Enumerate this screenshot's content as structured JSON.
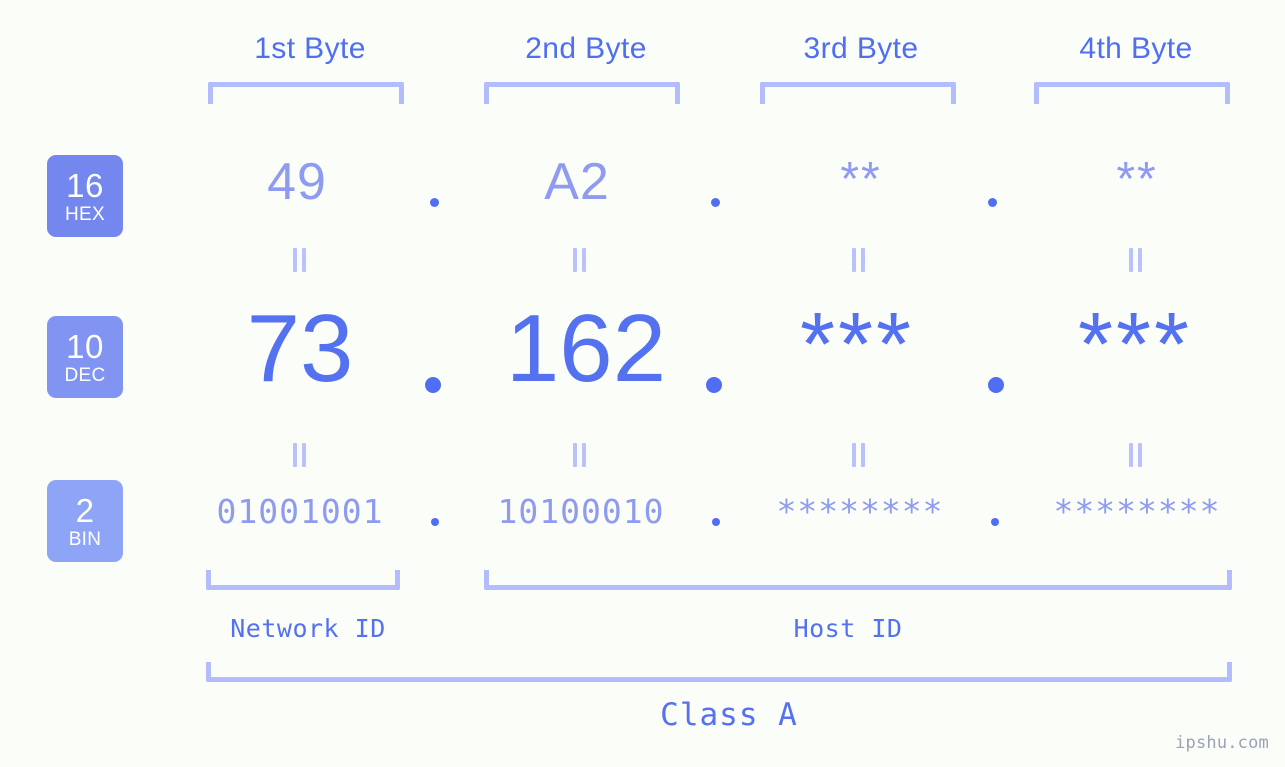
{
  "watermark": "ipshu.com",
  "columns": [
    {
      "header": "1st Byte"
    },
    {
      "header": "2nd Byte"
    },
    {
      "header": "3rd Byte"
    },
    {
      "header": "4th Byte"
    }
  ],
  "rows": [
    {
      "id": "hex",
      "badge_number": "16",
      "badge_label": "HEX",
      "badge_color": "#7387ee",
      "values": [
        "49",
        "A2",
        "**",
        "**"
      ]
    },
    {
      "id": "dec",
      "badge_number": "10",
      "badge_label": "DEC",
      "badge_color": "#8294f1",
      "values": [
        "73",
        "162",
        "***",
        "***"
      ]
    },
    {
      "id": "bin",
      "badge_number": "2",
      "badge_label": "BIN",
      "badge_color": "#8ea4f6",
      "values": [
        "01001001",
        "10100010",
        "********",
        "********"
      ]
    }
  ],
  "separator": ".",
  "footer": {
    "network_id_label": "Network ID",
    "host_id_label": "Host ID",
    "class_label": "Class A"
  },
  "colors": {
    "background": "#fbfdf9",
    "accent_strong": "#4f6ef2",
    "accent_mid": "#5471ef",
    "accent_light": "#8e9bf0",
    "bracket": "#b4bdfb"
  }
}
